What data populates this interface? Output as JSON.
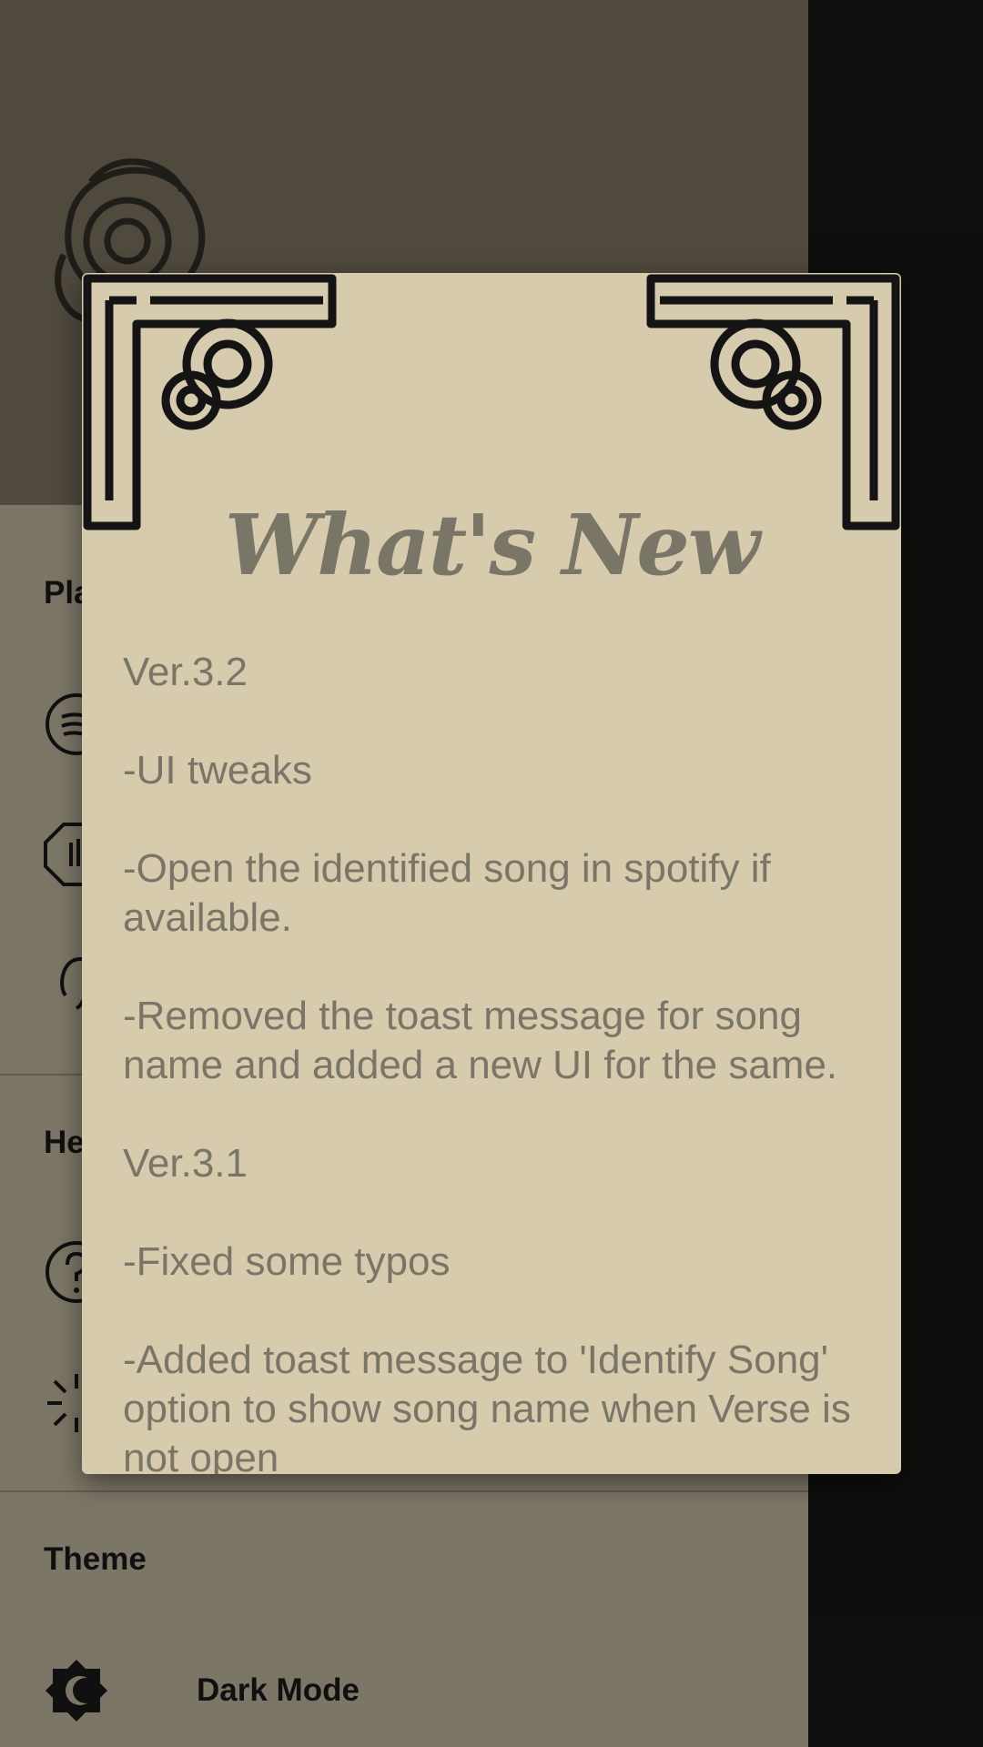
{
  "drawer": {
    "sections": [
      {
        "title": "Pla"
      },
      {
        "title": "He"
      },
      {
        "title": "Theme"
      }
    ],
    "dark_mode_label": "Dark Mode"
  },
  "dialog": {
    "title": "What's New",
    "lines": [
      "Ver.3.2",
      "-UI tweaks",
      "-Open the identified song in spotify if available.",
      "-Removed the toast message for song name and added a new UI for the same.",
      "Ver.3.1",
      "-Fixed some typos",
      "-Added toast message to 'Identify Song' option to show song name when Verse is not open"
    ]
  },
  "colors": {
    "dialog_bg": "#d7cbae",
    "dialog_text": "#7a7667",
    "drawer_bg": "#d6ccb0",
    "header_bg": "#8a7f6a"
  }
}
